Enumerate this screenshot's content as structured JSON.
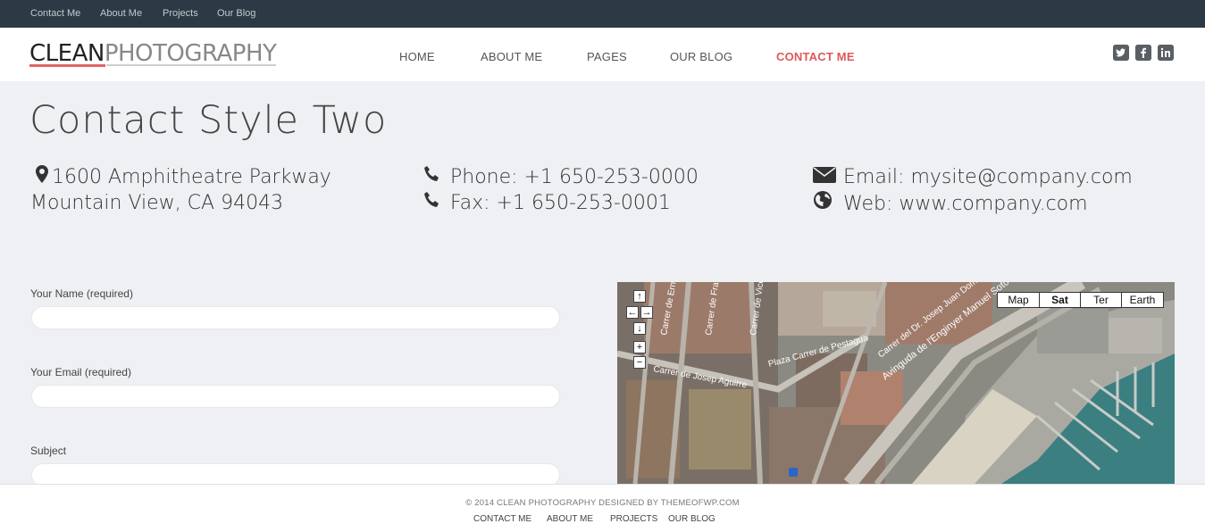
{
  "topbar": {
    "links": [
      "Contact Me",
      "About Me",
      "Projects",
      "Our Blog"
    ]
  },
  "header": {
    "logo_bold": "CLEAN",
    "logo_light": "PHOTOGRAPHY",
    "nav": [
      "HOME",
      "ABOUT ME",
      "PAGES",
      "OUR BLOG",
      "CONTACT ME"
    ],
    "active_nav": "CONTACT ME",
    "social": [
      "twitter-icon",
      "facebook-icon",
      "linkedin-icon"
    ]
  },
  "page": {
    "title": "Contact Style Two",
    "address_line1": "1600 Amphitheatre Parkway",
    "address_line2": "Mountain View, CA 94043",
    "phone": "Phone: +1 650-253-0000",
    "fax": "Fax: +1 650-253-0001",
    "email": "Email: mysite@company.com",
    "web": "Web: www.company.com"
  },
  "form": {
    "name_label": "Your Name (required)",
    "email_label": "Your Email (required)",
    "subject_label": "Subject",
    "name_value": "",
    "email_value": "",
    "subject_value": ""
  },
  "map": {
    "types": [
      "Map",
      "Sat",
      "Ter",
      "Earth"
    ],
    "selected_type": "Sat",
    "streets": [
      "Plaza",
      "Carrer de Josep Aguirre",
      "Carrer del Dr. Josep Juan Domine",
      "Avinguda de l'Enginyer Manuel Soto",
      "Carrer de Pestagua",
      "Carrer de Ernest",
      "Carrer de Francesc",
      "Carrer de Vicent"
    ]
  },
  "footer": {
    "copyright": "© 2014 CLEAN PHOTOGRAPHY DESIGNED BY THEMEOFWP.COM",
    "links": [
      "CONTACT ME",
      "ABOUT ME",
      "PROJECTS",
      "OUR BLOG"
    ]
  },
  "colors": {
    "accent": "#e05858",
    "topbar": "#2b3a44"
  }
}
